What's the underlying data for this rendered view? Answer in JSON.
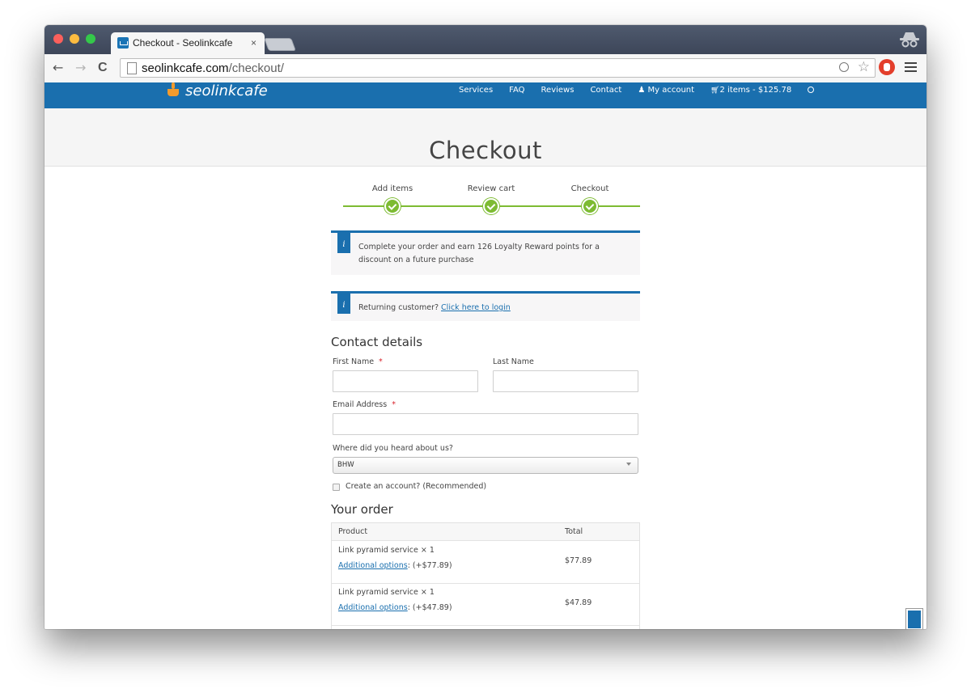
{
  "browser": {
    "tab_title": "Checkout - Seolinkcafe",
    "tab_close": "×",
    "url_domain": "seolinkcafe.com",
    "url_path": "/checkout/",
    "back": "←",
    "forward": "→",
    "reload": "C",
    "star": "☆"
  },
  "site": {
    "logo": "seolinkcafe",
    "brand_color": "#1a6fae",
    "accent_color": "#7dbb32",
    "nav": [
      "Services",
      "FAQ",
      "Reviews",
      "Contact"
    ],
    "account_label": "My account",
    "account_icon": "♟",
    "cart_label": "2 items - $125.78",
    "cart_icon": "🛒"
  },
  "page": {
    "title": "Checkout"
  },
  "steps": [
    "Add items",
    "Review cart",
    "Checkout"
  ],
  "notices": {
    "loyalty_icon": "i",
    "loyalty_text": "Complete your order and earn 126 Loyalty Reward points for a discount on a future purchase",
    "login_icon": "i",
    "login_prefix": "Returning customer?",
    "login_link": "Click here to login"
  },
  "contact": {
    "title": "Contact details",
    "first_name_label": "First Name",
    "last_name_label": "Last Name",
    "email_label": "Email Address",
    "required_mark": "*",
    "heard_label": "Where did you heard about us?",
    "heard_value": "BHW",
    "create_account_label": "Create an account? (Recommended)"
  },
  "order": {
    "title": "Your order",
    "col_product": "Product",
    "col_total": "Total",
    "rows": [
      {
        "product": "Link pyramid service × 1",
        "options_link": "Additional options",
        "options_price": ": (+$77.89)",
        "total": "$77.89"
      },
      {
        "product": "Link pyramid service × 1",
        "options_link": "Additional options",
        "options_price": ": (+$47.89)",
        "total": "$47.89"
      }
    ]
  }
}
